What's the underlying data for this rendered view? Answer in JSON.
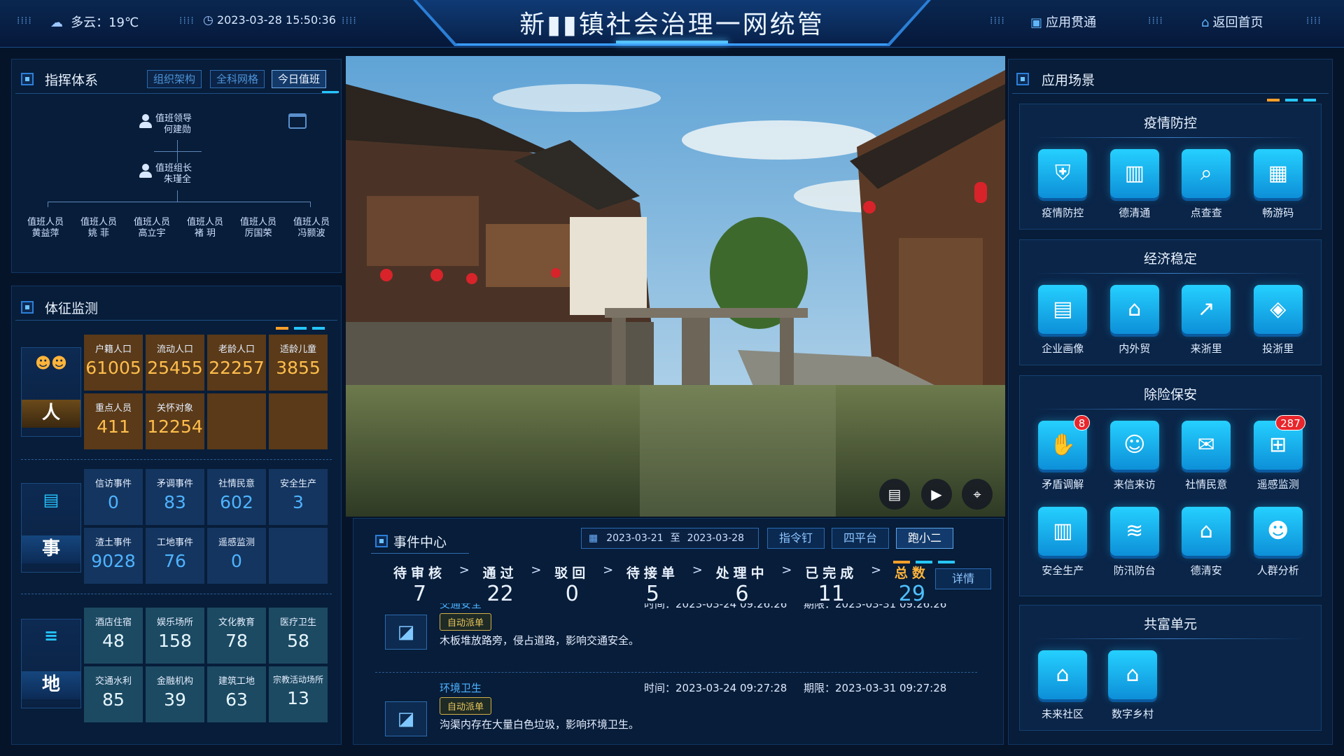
{
  "header": {
    "weather": "多云：19℃",
    "datetime": "2023-03-28 15:50:36",
    "title": "新▮▮镇社会治理一网统管",
    "nav_apps": "应用贯通",
    "nav_home": "返回首页"
  },
  "command": {
    "title": "指挥体系",
    "tabs": [
      "组织架构",
      "全科网格",
      "今日值班"
    ],
    "leader": {
      "role": "值班领导",
      "name": "何建勋"
    },
    "group_leader": {
      "role": "值班组长",
      "name": "朱瑾全"
    },
    "staff": [
      {
        "role": "值班人员",
        "name": "黄益萍"
      },
      {
        "role": "值班人员",
        "name": "姚 菲"
      },
      {
        "role": "值班人员",
        "name": "高立宇"
      },
      {
        "role": "值班人员",
        "name": "褚 玥"
      },
      {
        "role": "值班人员",
        "name": "厉国荣"
      },
      {
        "role": "值班人员",
        "name": "冯颢波"
      }
    ]
  },
  "monitor": {
    "title": "体征监测",
    "categories": {
      "people": "人",
      "events": "事",
      "places": "地"
    },
    "people": [
      {
        "label": "户籍人口",
        "value": "61005"
      },
      {
        "label": "流动人口",
        "value": "25455"
      },
      {
        "label": "老龄人口",
        "value": "22257"
      },
      {
        "label": "适龄儿童",
        "value": "3855"
      },
      {
        "label": "重点人员",
        "value": "411"
      },
      {
        "label": "关怀对象",
        "value": "12254"
      }
    ],
    "events": [
      {
        "label": "信访事件",
        "value": "0"
      },
      {
        "label": "矛调事件",
        "value": "83"
      },
      {
        "label": "社情民意",
        "value": "602"
      },
      {
        "label": "安全生产",
        "value": "3"
      },
      {
        "label": "渣土事件",
        "value": "9028"
      },
      {
        "label": "工地事件",
        "value": "76"
      },
      {
        "label": "遥感监测",
        "value": "0"
      }
    ],
    "places": [
      {
        "label": "酒店住宿",
        "value": "48"
      },
      {
        "label": "娱乐场所",
        "value": "158"
      },
      {
        "label": "文化教育",
        "value": "78"
      },
      {
        "label": "医疗卫生",
        "value": "58"
      },
      {
        "label": "交通水利",
        "value": "85"
      },
      {
        "label": "金融机构",
        "value": "39"
      },
      {
        "label": "建筑工地",
        "value": "63"
      },
      {
        "label": "宗教活动场所",
        "value": "13"
      }
    ]
  },
  "events_center": {
    "title": "事件中心",
    "date_from": "2023-03-21",
    "date_sep": "至",
    "date_to": "2023-03-28",
    "buttons": [
      "指令钉",
      "四平台",
      "跑小二"
    ],
    "flow": [
      {
        "label": "待审核",
        "value": "7"
      },
      {
        "label": "通过",
        "value": "22"
      },
      {
        "label": "驳回",
        "value": "0"
      },
      {
        "label": "待接单",
        "value": "5"
      },
      {
        "label": "处理中",
        "value": "6"
      },
      {
        "label": "已完成",
        "value": "11"
      },
      {
        "label": "总数",
        "value": "29"
      }
    ],
    "detail_btn": "详情",
    "items": [
      {
        "title": "交通安全",
        "time": "时间：2023-03-24 09:26:26",
        "deadline": "期限：2023-03-31 09:26:26",
        "tag": "自动派单",
        "desc": "木板堆放路旁，侵占道路，影响交通安全。"
      },
      {
        "title": "环境卫生",
        "time": "时间：2023-03-24 09:27:28",
        "deadline": "期限：2023-03-31 09:27:28",
        "tag": "自动派单",
        "desc": "沟渠内存在大量白色垃圾，影响环境卫生。"
      }
    ]
  },
  "apps": {
    "title": "应用场景",
    "groups": [
      {
        "title": "疫情防控",
        "items": [
          {
            "label": "疫情防控",
            "icon": "epidemic-icon",
            "glyph": "⛨"
          },
          {
            "label": "德清通",
            "icon": "building-icon",
            "glyph": "▥"
          },
          {
            "label": "点查查",
            "icon": "search-doc-icon",
            "glyph": "⌕"
          },
          {
            "label": "畅游码",
            "icon": "qr-code-icon",
            "glyph": "▦"
          }
        ]
      },
      {
        "title": "经济稳定",
        "items": [
          {
            "label": "企业画像",
            "icon": "enterprise-icon",
            "glyph": "▤"
          },
          {
            "label": "内外贸",
            "icon": "trade-icon",
            "glyph": "⌂"
          },
          {
            "label": "来浙里",
            "icon": "chart-up-icon",
            "glyph": "↗"
          },
          {
            "label": "投浙里",
            "icon": "invest-icon",
            "glyph": "◈"
          }
        ]
      },
      {
        "title": "除险保安",
        "items": [
          {
            "label": "矛盾调解",
            "icon": "handshake-icon",
            "glyph": "✋",
            "badge": "8"
          },
          {
            "label": "来信来访",
            "icon": "visitor-icon",
            "glyph": "☺"
          },
          {
            "label": "社情民意",
            "icon": "chat-icon",
            "glyph": "✉"
          },
          {
            "label": "遥感监测",
            "icon": "satellite-icon",
            "glyph": "⊞",
            "badge": "287"
          },
          {
            "label": "安全生产",
            "icon": "factory-icon",
            "glyph": "▥"
          },
          {
            "label": "防汛防台",
            "icon": "flood-icon",
            "glyph": "≋"
          },
          {
            "label": "德清安",
            "icon": "home-search-icon",
            "glyph": "⌂"
          },
          {
            "label": "人群分析",
            "icon": "crowd-icon",
            "glyph": "☻"
          }
        ]
      },
      {
        "title": "共富单元",
        "items": [
          {
            "label": "未来社区",
            "icon": "community-icon",
            "glyph": "⌂"
          },
          {
            "label": "数字乡村",
            "icon": "village-icon",
            "glyph": "⌂"
          }
        ]
      }
    ]
  },
  "colors": {
    "accent": "#3fa3ff",
    "orange": "#ffbe4d",
    "cyan": "#25d0ff",
    "badge": "#e8262c"
  }
}
